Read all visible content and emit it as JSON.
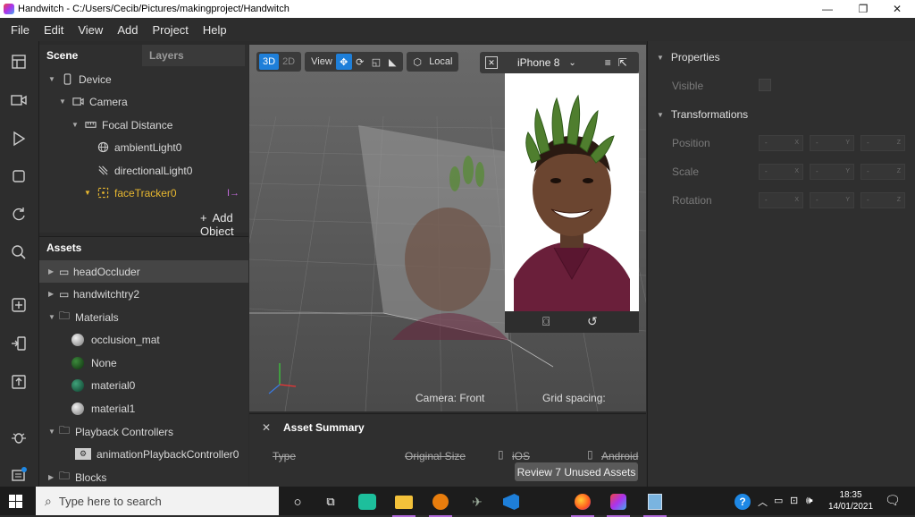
{
  "window": {
    "app_name": "Handwitch",
    "path": "C:/Users/Cecib/Pictures/makingproject/Handwitch",
    "title_sep": " - "
  },
  "menu": [
    "File",
    "Edit",
    "View",
    "Add",
    "Project",
    "Help"
  ],
  "scene": {
    "tabs": [
      "Scene",
      "Layers"
    ],
    "tree": [
      {
        "label": "Device",
        "icon": "device-icon"
      },
      {
        "label": "Camera",
        "icon": "camera-icon"
      },
      {
        "label": "Focal Distance",
        "icon": "focal-distance-icon"
      },
      {
        "label": "ambientLight0",
        "icon": "ambient-light-icon"
      },
      {
        "label": "directionalLight0",
        "icon": "directional-light-icon"
      },
      {
        "label": "faceTracker0",
        "icon": "face-tracker-icon"
      }
    ],
    "add_object": "Add Object"
  },
  "assets": {
    "title": "Assets",
    "items": [
      {
        "label": "headOccluder",
        "icon": "file-icon"
      },
      {
        "label": "handwitchtry2",
        "icon": "file-icon"
      },
      {
        "label": "Materials",
        "icon": "folder-icon"
      },
      {
        "label": "occlusion_mat",
        "icon": "material-ball-icon",
        "color": "#bdbdbd"
      },
      {
        "label": "None",
        "icon": "material-ball-icon",
        "color": "#1f5e1f"
      },
      {
        "label": "material0",
        "icon": "material-ball-icon",
        "color": "#1f6e52"
      },
      {
        "label": "material1",
        "icon": "material-ball-icon",
        "color": "#bdbdbd"
      },
      {
        "label": "Playback Controllers",
        "icon": "folder-icon"
      },
      {
        "label": "animationPlaybackController0",
        "icon": "playback-controller-icon"
      },
      {
        "label": "Blocks",
        "icon": "folder-icon"
      }
    ]
  },
  "viewport": {
    "mode_3d": "3D",
    "mode_2d": "2D",
    "view_label": "View",
    "local_label": "Local",
    "device_name": "iPhone 8",
    "camera_caption": "Camera: Front",
    "grid_caption": "Grid spacing:"
  },
  "asset_summary": {
    "title": "Asset Summary",
    "col_type": "Type",
    "col_size": "Original Size",
    "col_ios": "iOS",
    "col_android": "Android",
    "review_button": "Review 7 Unused Assets"
  },
  "properties": {
    "title": "Properties",
    "visible_label": "Visible",
    "transformations_title": "Transformations",
    "rows": [
      "Position",
      "Scale",
      "Rotation"
    ],
    "placeholder": "-",
    "axes": [
      "X",
      "Y",
      "Z"
    ]
  },
  "taskbar": {
    "search_placeholder": "Type here to search",
    "time": "18:35",
    "date": "14/01/2021"
  },
  "colors": {
    "accent": "#1e7fd9",
    "face_tracker": "#e8b830",
    "shirt": "#6a1f3a"
  }
}
